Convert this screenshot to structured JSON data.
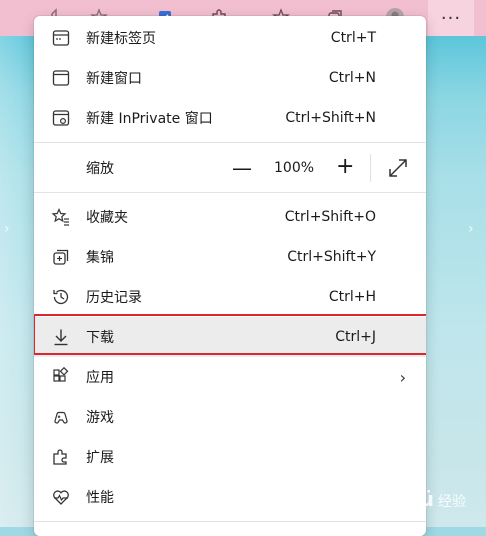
{
  "toolbar": {
    "more_label": "···"
  },
  "page": {
    "watermark_brand": "Baiдü",
    "watermark_suffix": "经验"
  },
  "menu": {
    "items": [
      {
        "label": "新建标签页",
        "shortcut": "Ctrl+T",
        "icon": "new-tab-icon"
      },
      {
        "label": "新建窗口",
        "shortcut": "Ctrl+N",
        "icon": "new-window-icon"
      },
      {
        "label": "新建 InPrivate 窗口",
        "shortcut": "Ctrl+Shift+N",
        "icon": "inprivate-window-icon"
      },
      {
        "label": "收藏夹",
        "shortcut": "Ctrl+Shift+O",
        "icon": "favorites-icon"
      },
      {
        "label": "集锦",
        "shortcut": "Ctrl+Shift+Y",
        "icon": "collections-icon"
      },
      {
        "label": "历史记录",
        "shortcut": "Ctrl+H",
        "icon": "history-icon"
      },
      {
        "label": "下载",
        "shortcut": "Ctrl+J",
        "icon": "download-icon",
        "highlighted": true
      },
      {
        "label": "应用",
        "shortcut": "",
        "icon": "apps-icon",
        "submenu": true
      },
      {
        "label": "游戏",
        "shortcut": "",
        "icon": "games-icon"
      },
      {
        "label": "扩展",
        "shortcut": "",
        "icon": "extensions-icon"
      },
      {
        "label": "性能",
        "shortcut": "",
        "icon": "performance-icon"
      }
    ],
    "zoom": {
      "label": "缩放",
      "minus": "—",
      "value": "100%",
      "plus": "+"
    },
    "highlight_color": "#d9262f"
  }
}
